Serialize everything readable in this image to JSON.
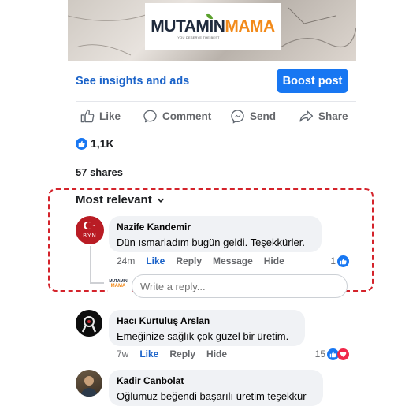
{
  "post": {
    "banner": {
      "logo_dark": "MUTAMIN",
      "logo_orange": "MAMA",
      "tagline": "YOU DESERVE THE BEST"
    },
    "insights_label": "See insights and ads",
    "boost_label": "Boost post",
    "actions": [
      {
        "label": "Like",
        "icon": "thumbs-up-icon"
      },
      {
        "label": "Comment",
        "icon": "comment-icon"
      },
      {
        "label": "Send",
        "icon": "messenger-icon"
      },
      {
        "label": "Share",
        "icon": "share-arrow-icon"
      }
    ],
    "reaction_count": "1,1K",
    "shares_label": "57 shares"
  },
  "comments": {
    "sort_label": "Most relevant",
    "items": [
      {
        "author": "Nazife Kandemir",
        "text": "Dün ısmarladım bugün geldi. Teşekkürler.",
        "time": "24m",
        "like_label": "Like",
        "reply_label": "Reply",
        "message_label": "Message",
        "hide_label": "Hide",
        "reaction_count": "1",
        "avatar": "turkish-flag-avatar",
        "avatar_letters": "ΒΥΝ"
      },
      {
        "author": "Hacı Kurtuluş Arslan",
        "text": "Emeğinize sağlık çok güzel bir üretim.",
        "time": "7w",
        "like_label": "Like",
        "reply_label": "Reply",
        "hide_label": "Hide",
        "reaction_count": "15",
        "avatar": "ribbon-avatar"
      },
      {
        "author": "Kadir Canbolat",
        "text": "Oğlumuz beğendi başarılı üretim teşekkür",
        "avatar": "photo-avatar"
      }
    ],
    "reply_placeholder": "Write a reply...",
    "reply_avatar": {
      "dark": "MUTAMIN",
      "orange": "MAMA"
    }
  },
  "colors": {
    "accent": "#1877f2",
    "link": "#1b63c9",
    "highlight_border": "#d4232b",
    "bubble": "#f0f2f5",
    "heart": "#f0284a"
  }
}
